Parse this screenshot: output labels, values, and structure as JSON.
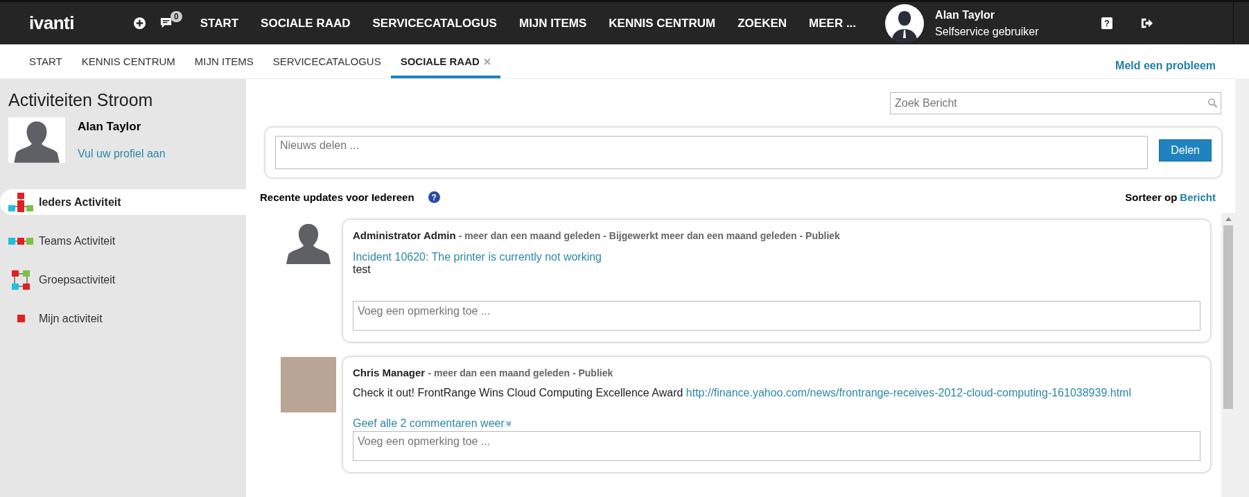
{
  "top_nav": {
    "logo": "ivanti",
    "notification_count": "0",
    "items": [
      "START",
      "SOCIALE RAAD",
      "SERVICECATALOGUS",
      "MIJN ITEMS",
      "KENNIS CENTRUM",
      "ZOEKEN",
      "MEER ..."
    ],
    "user": {
      "name": "Alan Taylor",
      "role": "Selfservice gebruiker"
    },
    "help_icon": "?"
  },
  "tabs": [
    {
      "label": "START",
      "selected": false,
      "closable": false
    },
    {
      "label": "KENNIS CENTRUM",
      "selected": false,
      "closable": false
    },
    {
      "label": "MIJN ITEMS",
      "selected": false,
      "closable": false
    },
    {
      "label": "SERVICECATALOGUS",
      "selected": false,
      "closable": false
    },
    {
      "label": "SOCIALE RAAD",
      "selected": true,
      "closable": true
    }
  ],
  "report_link": "Meld een probleem",
  "sidebar": {
    "title": "Activiteiten Stroom",
    "profile": {
      "name": "Alan Taylor",
      "link": "Vul uw profiel aan"
    },
    "items": [
      {
        "label": "Ieders Activiteit",
        "kind": "everyone",
        "selected": true
      },
      {
        "label": "Teams Activiteit",
        "kind": "teams",
        "selected": false
      },
      {
        "label": "Groepsactiviteit",
        "kind": "groups",
        "selected": false
      },
      {
        "label": "Mijn activiteit",
        "kind": "mine",
        "selected": false
      }
    ]
  },
  "search": {
    "placeholder": "Zoek Bericht"
  },
  "share": {
    "placeholder": "Nieuws delen ...",
    "button": "Delen"
  },
  "feed": {
    "heading": "Recente updates voor Iedereen",
    "sort_label": "Sorteer op",
    "sort_value": "Bericht",
    "help_icon": "?",
    "posts": [
      {
        "kind": "silhouette",
        "author": "Administrator Admin",
        "meta": "- meer dan een maand geleden - Bijgewerkt meer dan een maand geleden - Publiek",
        "link": "Incident 10620: The printer is currently not working",
        "text": "test",
        "comment_placeholder": "Voeg een opmerking toe ..."
      },
      {
        "kind": "photo",
        "author": "Chris Manager",
        "meta": "- meer dan een maand geleden - Publiek",
        "text": "Check it out! FrontRange Wins Cloud Computing Excellence Award",
        "url": "http://finance.yahoo.com/news/frontrange-receives-2012-cloud-computing-161038939.html",
        "show_comments": "Geef alle 2 commentaren weer",
        "comment_placeholder": "Voeg een opmerking toe ..."
      }
    ]
  }
}
